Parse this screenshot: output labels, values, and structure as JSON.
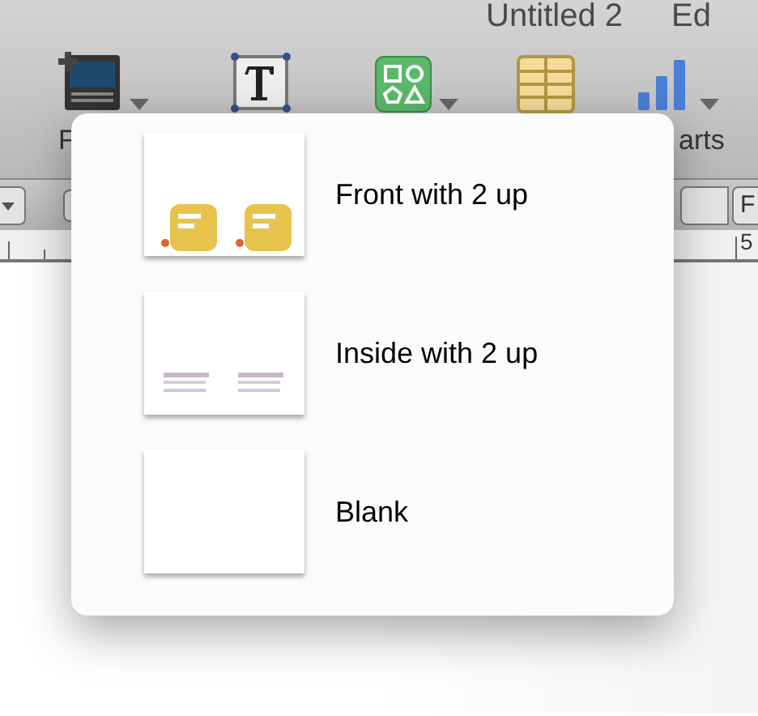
{
  "window": {
    "title": "Untitled 2",
    "title_suffix": "Ed"
  },
  "toolbar": [
    {
      "kind": "media",
      "label": "F",
      "menu": true
    },
    {
      "kind": "text",
      "menu": false
    },
    {
      "kind": "shapes",
      "menu": true
    },
    {
      "kind": "table",
      "menu": false
    },
    {
      "kind": "charts",
      "label": "arts",
      "menu": true
    }
  ],
  "format_bar": {
    "right_label": "F"
  },
  "ruler": {
    "mark": "5"
  },
  "popover": {
    "items": [
      {
        "kind": "front",
        "label": "Front with 2 up"
      },
      {
        "kind": "inside",
        "label": "Inside with 2 up"
      },
      {
        "kind": "blank",
        "label": "Blank"
      }
    ]
  }
}
